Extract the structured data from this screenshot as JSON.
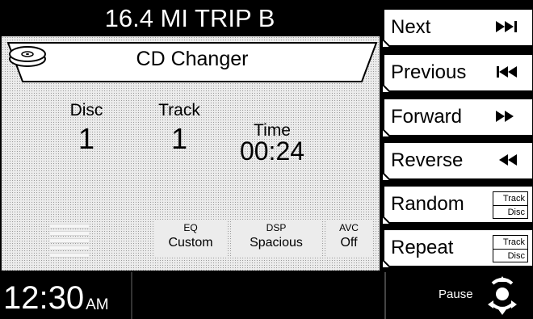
{
  "top_banner": {
    "text": "16.4 MI TRIP B"
  },
  "source_header": {
    "title": "CD Changer",
    "icon": "cd-stack-icon"
  },
  "disc": {
    "label": "Disc",
    "value": "1"
  },
  "track": {
    "label": "Track",
    "value": "1"
  },
  "time": {
    "label": "Time",
    "value": "00:24"
  },
  "settings": [
    {
      "label": "EQ",
      "value": "Custom"
    },
    {
      "label": "DSP",
      "value": "Spacious"
    },
    {
      "label": "AVC",
      "value": "Off"
    }
  ],
  "side_buttons": {
    "next": {
      "label": "Next",
      "icon": "skip-next-icon"
    },
    "previous": {
      "label": "Previous",
      "icon": "skip-previous-icon"
    },
    "forward": {
      "label": "Forward",
      "icon": "fast-forward-icon"
    },
    "reverse": {
      "label": "Reverse",
      "icon": "rewind-icon"
    },
    "random": {
      "label": "Random",
      "options": [
        "Track",
        "Disc"
      ]
    },
    "repeat": {
      "label": "Repeat",
      "options": [
        "Track",
        "Disc"
      ]
    }
  },
  "clock": {
    "time": "12:30",
    "ampm": "AM"
  },
  "pause": {
    "label": "Pause",
    "icon": "joystick-icon"
  },
  "colors": {
    "background": "#000000",
    "panel": "#ececec",
    "button": "#ffffff",
    "text": "#000000"
  }
}
